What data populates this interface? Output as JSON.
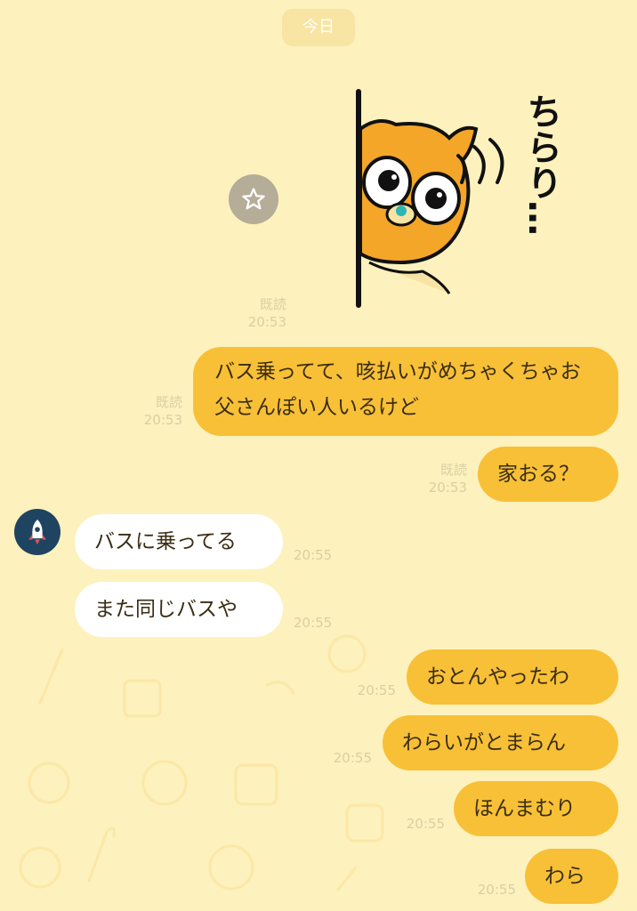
{
  "date_divider": "今日",
  "messages": [
    {
      "side": "out",
      "type": "sticker",
      "read": "既読",
      "time": "20:53"
    },
    {
      "side": "out",
      "text": "バス乗ってて、咳払いがめちゃくちゃお父さんぽい人いるけど",
      "read": "既読",
      "time": "20:53"
    },
    {
      "side": "out",
      "text": "家おる？",
      "read": "既読",
      "time": "20:53"
    },
    {
      "side": "in",
      "text": "バスに乗ってる",
      "time": "20:55"
    },
    {
      "side": "in",
      "text": "また同じバスや",
      "time": "20:55"
    },
    {
      "side": "out",
      "text": "おとんやったわ",
      "time": "20:55"
    },
    {
      "side": "out",
      "text": "わらいがとまらん",
      "time": "20:55"
    },
    {
      "side": "out",
      "text": "ほんまむり",
      "time": "20:55"
    },
    {
      "side": "out",
      "text": "わら",
      "time": "20:55"
    }
  ],
  "sticker": {
    "caption": "ちらり…"
  },
  "colors": {
    "background": "#fdf1bd",
    "outgoing_bubble": "#f8c036",
    "incoming_bubble": "#ffffff",
    "avatar": "#1f4461"
  },
  "icons": {
    "favorite": "star-icon",
    "avatar": "rocket-icon"
  }
}
